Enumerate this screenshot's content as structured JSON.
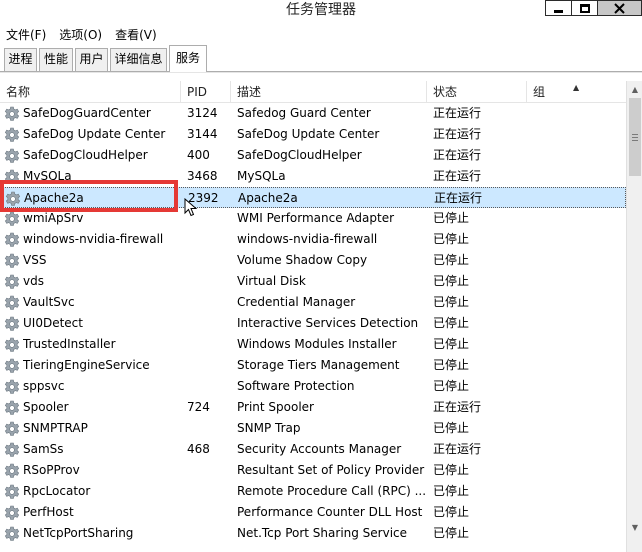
{
  "window": {
    "title": "任务管理器"
  },
  "menu": [
    {
      "label": "文件(F)"
    },
    {
      "label": "选项(O)"
    },
    {
      "label": "查看(V)"
    }
  ],
  "tabs": [
    {
      "label": "进程",
      "active": false
    },
    {
      "label": "性能",
      "active": false
    },
    {
      "label": "用户",
      "active": false
    },
    {
      "label": "详细信息",
      "active": false
    },
    {
      "label": "服务",
      "active": true
    }
  ],
  "columns": {
    "name": "名称",
    "pid": "PID",
    "desc": "描述",
    "status": "状态",
    "group": "组"
  },
  "services": [
    {
      "name": "SafeDogGuardCenter",
      "pid": "3124",
      "desc": "Safedog Guard Center",
      "status": "正在运行"
    },
    {
      "name": "SafeDog Update Center",
      "pid": "3144",
      "desc": "SafeDog Update Center",
      "status": "正在运行"
    },
    {
      "name": "SafeDogCloudHelper",
      "pid": "400",
      "desc": "SafeDogCloudHelper",
      "status": "正在运行"
    },
    {
      "name": "MySQLa",
      "pid": "3468",
      "desc": "MySQLa",
      "status": "正在运行"
    },
    {
      "name": "Apache2a",
      "pid": "2392",
      "desc": "Apache2a",
      "status": "正在运行",
      "selected": true
    },
    {
      "name": "wmiApSrv",
      "pid": "",
      "desc": "WMI Performance Adapter",
      "status": "已停止"
    },
    {
      "name": "windows-nvidia-firewall",
      "pid": "",
      "desc": "windows-nvidia-firewall",
      "status": "已停止"
    },
    {
      "name": "VSS",
      "pid": "",
      "desc": "Volume Shadow Copy",
      "status": "已停止"
    },
    {
      "name": "vds",
      "pid": "",
      "desc": "Virtual Disk",
      "status": "已停止"
    },
    {
      "name": "VaultSvc",
      "pid": "",
      "desc": "Credential Manager",
      "status": "已停止"
    },
    {
      "name": "UI0Detect",
      "pid": "",
      "desc": "Interactive Services Detection",
      "status": "已停止"
    },
    {
      "name": "TrustedInstaller",
      "pid": "",
      "desc": "Windows Modules Installer",
      "status": "已停止"
    },
    {
      "name": "TieringEngineService",
      "pid": "",
      "desc": "Storage Tiers Management",
      "status": "已停止"
    },
    {
      "name": "sppsvc",
      "pid": "",
      "desc": "Software Protection",
      "status": "已停止"
    },
    {
      "name": "Spooler",
      "pid": "724",
      "desc": "Print Spooler",
      "status": "正在运行"
    },
    {
      "name": "SNMPTRAP",
      "pid": "",
      "desc": "SNMP Trap",
      "status": "已停止"
    },
    {
      "name": "SamSs",
      "pid": "468",
      "desc": "Security Accounts Manager",
      "status": "正在运行"
    },
    {
      "name": "RSoPProv",
      "pid": "",
      "desc": "Resultant Set of Policy Provider",
      "status": "已停止"
    },
    {
      "name": "RpcLocator",
      "pid": "",
      "desc": "Remote Procedure Call (RPC) ...",
      "status": "已停止"
    },
    {
      "name": "PerfHost",
      "pid": "",
      "desc": "Performance Counter DLL Host",
      "status": "已停止"
    },
    {
      "name": "NetTcpPortSharing",
      "pid": "",
      "desc": "Net.Tcp Port Sharing Service",
      "status": "已停止"
    }
  ],
  "colors": {
    "selection": "#cce8ff",
    "highlight_box": "#e53935"
  }
}
